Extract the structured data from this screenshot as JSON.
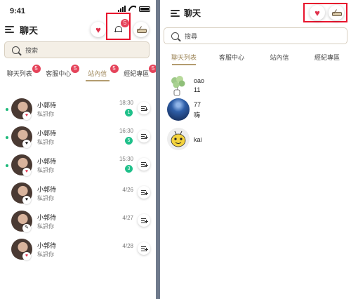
{
  "left": {
    "status": {
      "time": "9:41"
    },
    "header": {
      "title": "聊天",
      "notif_badge": "5"
    },
    "search": {
      "placeholder": "搜索"
    },
    "tabs": [
      {
        "label": "聊天列表",
        "badge": "5",
        "active": false
      },
      {
        "label": "客服中心",
        "badge": "5",
        "active": false
      },
      {
        "label": "站內信",
        "badge": "5",
        "active": true
      },
      {
        "label": "經紀專區",
        "badge": "5",
        "active": false
      }
    ],
    "chats": [
      {
        "name": "小郭待",
        "message": "私訊你",
        "time": "18:30",
        "count": "1",
        "online": true,
        "mini": "♥",
        "mini_style": "red"
      },
      {
        "name": "小郭待",
        "message": "私訊你",
        "time": "16:30",
        "count": "5",
        "online": true,
        "mini": "♥",
        "mini_style": "black"
      },
      {
        "name": "小郭待",
        "message": "私訊你",
        "time": "15:30",
        "count": "3",
        "online": true,
        "mini": "♥",
        "mini_style": "red"
      },
      {
        "name": "小郭待",
        "message": "私訊你",
        "time": "4/26",
        "count": "",
        "online": false,
        "mini": "♥",
        "mini_style": "black"
      },
      {
        "name": "小郭待",
        "message": "私訊你",
        "time": "4/27",
        "count": "",
        "online": false,
        "mini": "✎",
        "mini_style": "black"
      },
      {
        "name": "小郭待",
        "message": "私訊你",
        "time": "4/28",
        "count": "",
        "online": false,
        "mini": "♥",
        "mini_style": "red"
      }
    ]
  },
  "right": {
    "header": {
      "title": "聊天"
    },
    "search": {
      "placeholder": "搜尋"
    },
    "tabs": [
      {
        "label": "聊天列表",
        "active": true
      },
      {
        "label": "客服中心",
        "active": false
      },
      {
        "label": "站內信",
        "active": false
      },
      {
        "label": "經紀專區",
        "active": false
      }
    ],
    "chats": [
      {
        "name": "oao",
        "sub": "11"
      },
      {
        "name": "77",
        "sub": "嗨"
      },
      {
        "name": "kai",
        "sub": ""
      }
    ]
  },
  "colors": {
    "accent": "#b39c6f",
    "badge": "#e5435a",
    "highlight": "#e8142d",
    "online": "#1db97a",
    "divider": "#6f7a8c"
  }
}
